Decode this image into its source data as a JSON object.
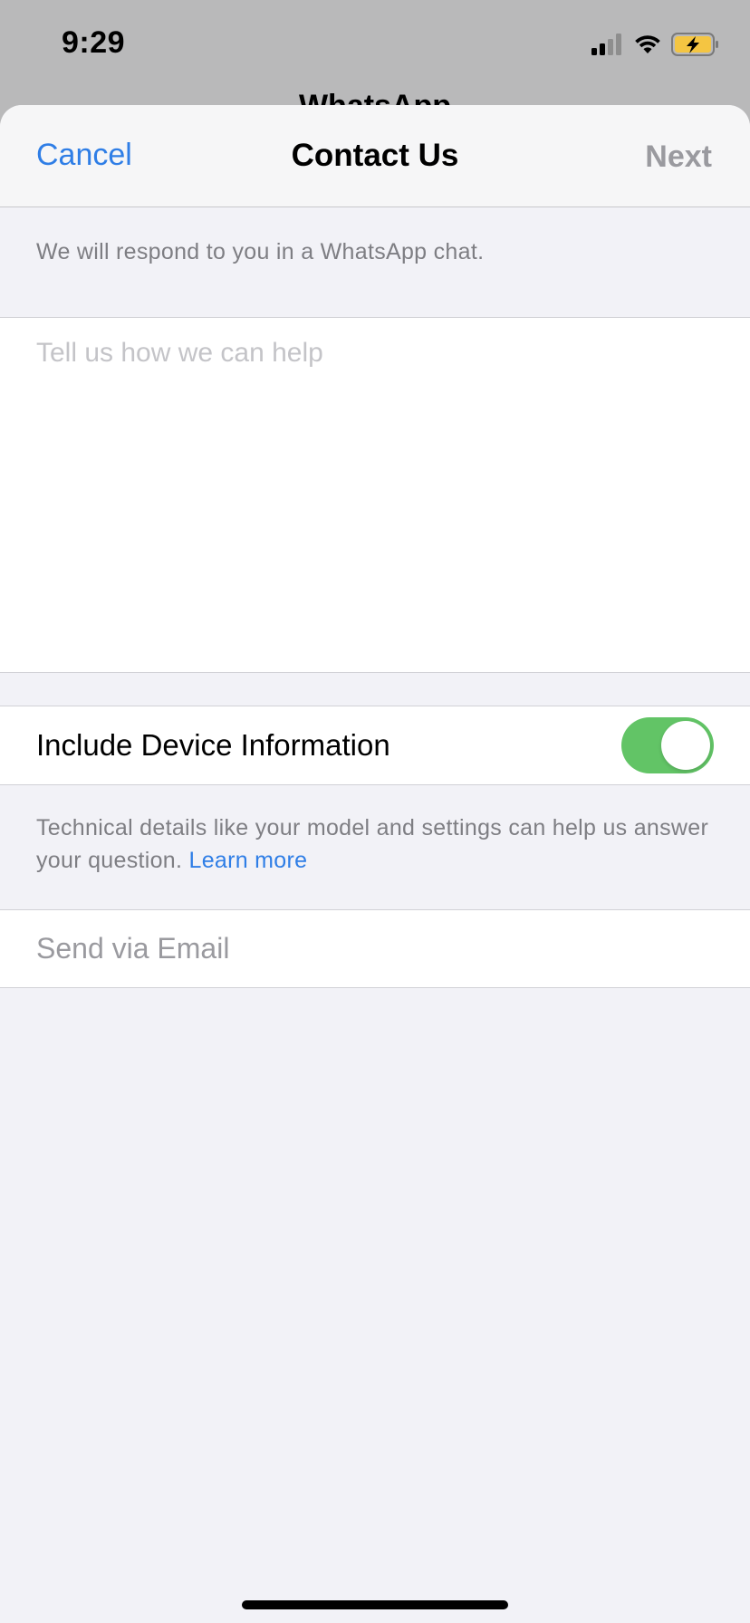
{
  "status_bar": {
    "time": "9:29",
    "icons": [
      "cellular-signal-icon",
      "wifi-icon",
      "battery-charging-icon"
    ],
    "battery_color": "#f4c542"
  },
  "background": {
    "partial_title": "WhatsApp"
  },
  "nav": {
    "cancel_label": "Cancel",
    "title": "Contact Us",
    "next_label": "Next"
  },
  "intro_text": "We will respond to you in a WhatsApp chat.",
  "message": {
    "value": "",
    "placeholder": "Tell us how we can help"
  },
  "device_info": {
    "label": "Include Device Information",
    "enabled": true,
    "footnote": "Technical details like your model and settings can help us answer your question.",
    "learn_more": "Learn more"
  },
  "email": {
    "label": "Send via Email"
  },
  "colors": {
    "accent": "#2f7ee6",
    "toggle_on": "#62c466",
    "disabled_text": "#9a9a9f"
  }
}
